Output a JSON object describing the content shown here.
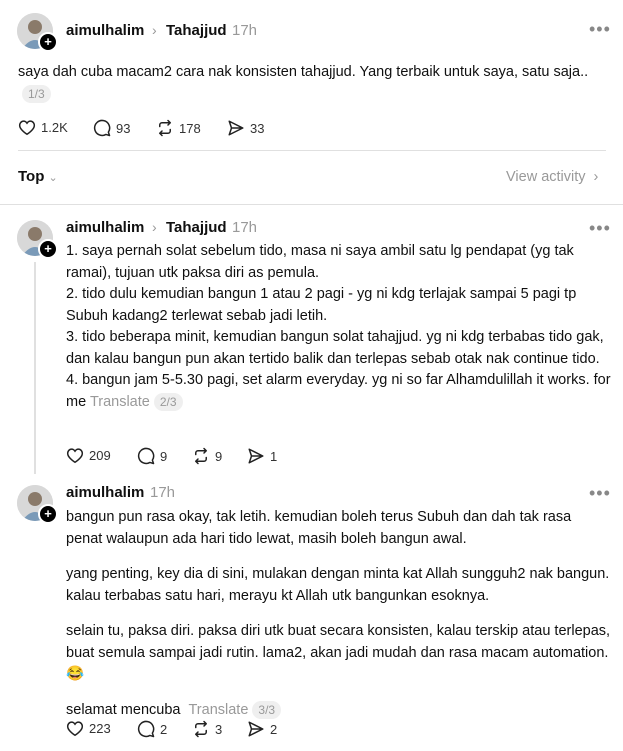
{
  "post": {
    "username": "aimulhalim",
    "topic": "Tahajjud",
    "time": "17h",
    "text": "saya dah cuba macam2 cara nak konsisten tahajjud. Yang terbaik untuk saya, satu saja..",
    "page": "1/3",
    "likes": "1.2K",
    "replies": "93",
    "reposts": "178",
    "shares": "33"
  },
  "sort": {
    "label": "Top",
    "view_activity": "View activity"
  },
  "reply1": {
    "username": "aimulhalim",
    "topic": "Tahajjud",
    "time": "17h",
    "lines": [
      "1. saya pernah solat sebelum tido, masa ni saya ambil satu lg pendapat (yg tak ramai), tujuan utk paksa diri as pemula.",
      "2. tido dulu kemudian bangun 1 atau 2 pagi - yg ni kdg terlajak sampai 5 pagi tp Subuh kadang2 terlewat sebab jadi letih.",
      "3. tido beberapa minit, kemudian bangun solat tahajjud. yg ni kdg terbabas tido gak, dan kalau bangun pun akan tertido balik dan terlepas sebab otak nak continue tido.",
      "4. bangun jam 5-5.30 pagi, set alarm everyday. yg ni so far Alhamdulillah it works. for me"
    ],
    "translate": "Translate",
    "page": "2/3",
    "likes": "209",
    "replies": "9",
    "reposts": "9",
    "shares": "1"
  },
  "reply2": {
    "username": "aimulhalim",
    "time": "17h",
    "para1": "bangun pun rasa okay, tak letih. kemudian boleh terus Subuh dan dah tak rasa penat walaupun ada hari tido lewat, masih boleh bangun awal.",
    "para2": "yang penting, key dia di sini, mulakan dengan minta kat Allah sungguh2 nak bangun. kalau terbabas satu hari, merayu kt Allah utk bangunkan esoknya.",
    "para3": "selain tu, paksa diri. paksa diri utk buat secara konsisten, kalau terskip atau terlepas, buat semula sampai jadi rutin. lama2, akan jadi mudah dan rasa macam automation. 😂",
    "para4": "selamat mencuba",
    "translate": "Translate",
    "page": "3/3",
    "likes": "223",
    "replies": "2",
    "reposts": "3",
    "shares": "2"
  }
}
